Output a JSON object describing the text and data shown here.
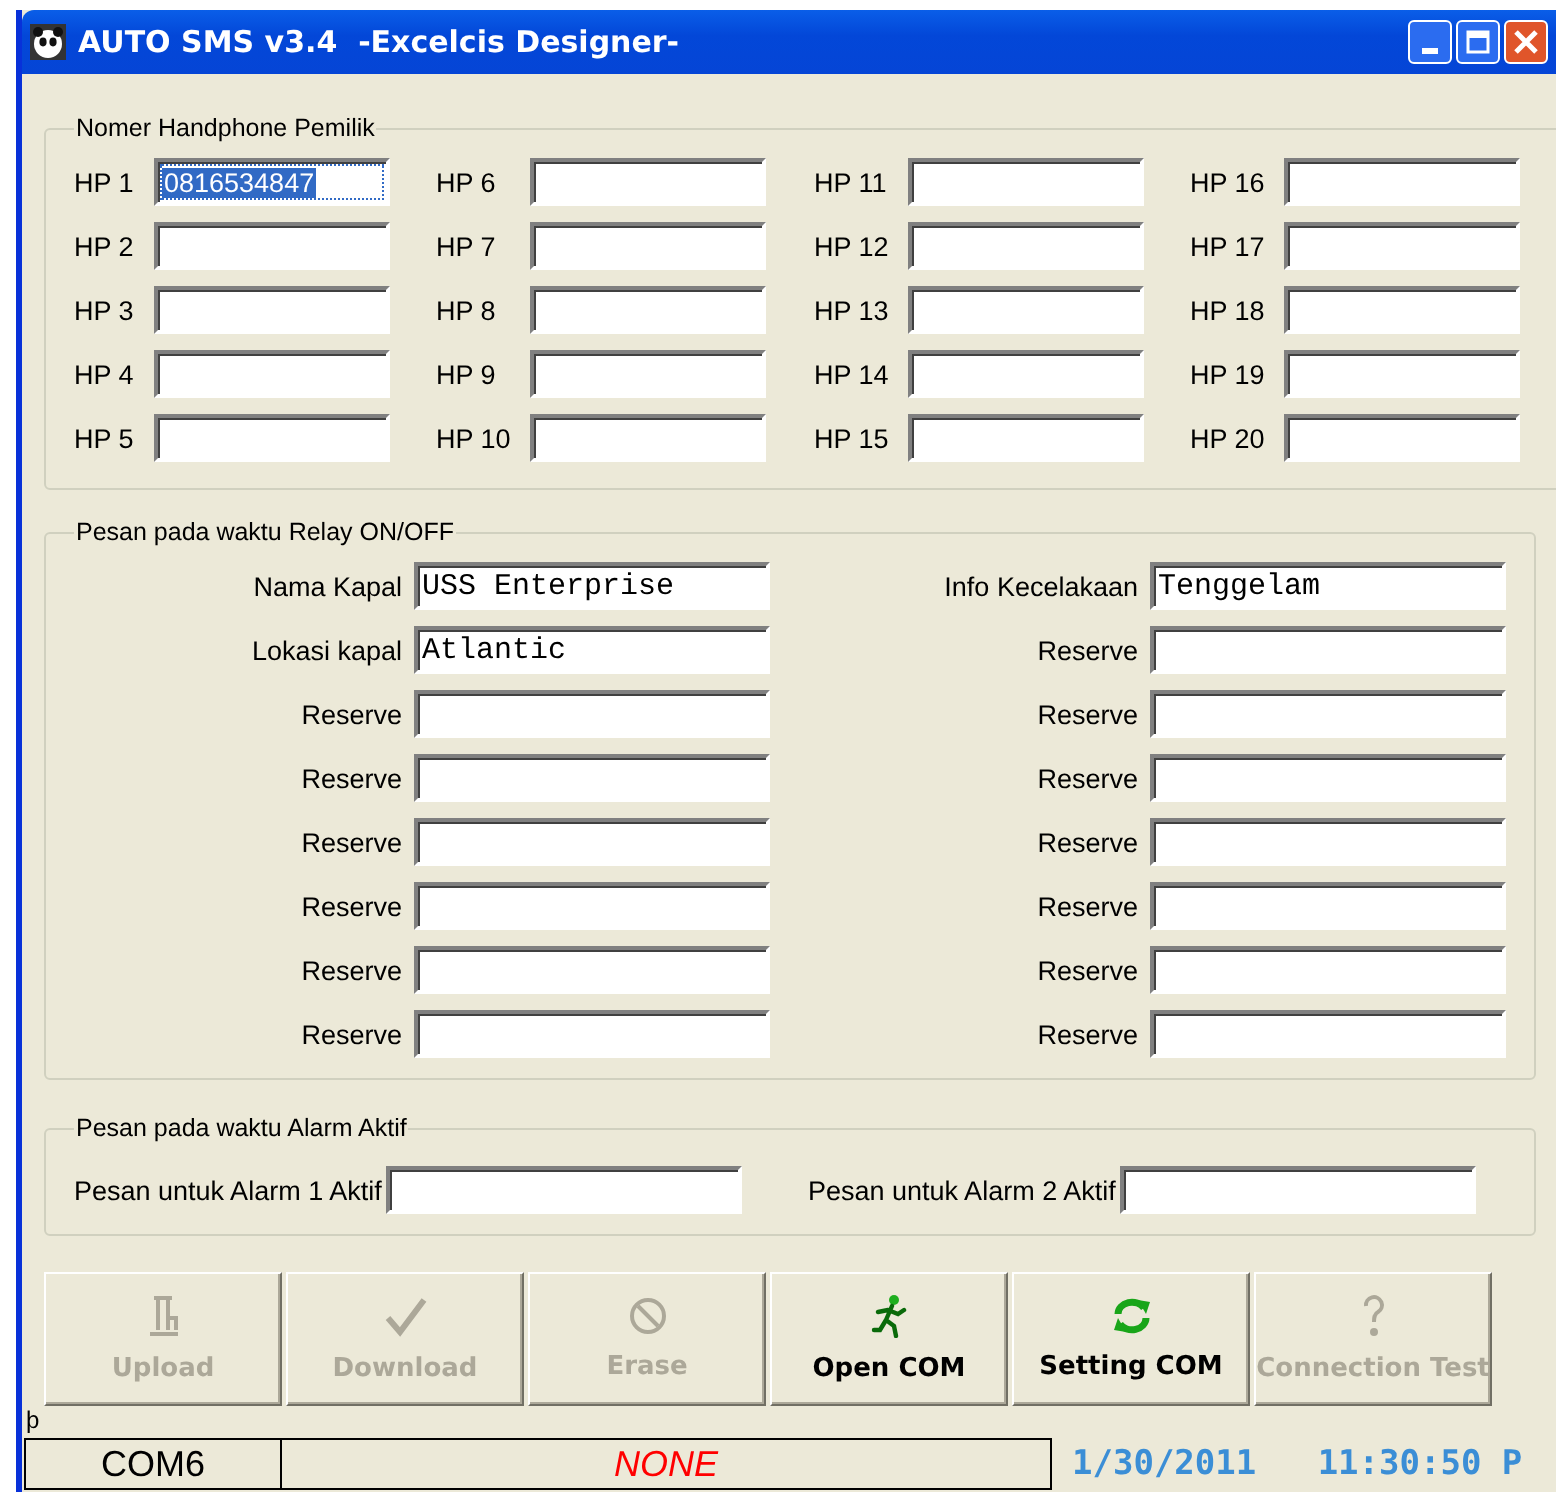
{
  "window": {
    "title": "AUTO SMS v3.4  -Excelcis Designer-"
  },
  "owner_phones": {
    "title": "Nomer Handphone Pemilik",
    "fields": [
      {
        "label": "HP 1",
        "value": "0816534847",
        "selected": true
      },
      {
        "label": "HP 2",
        "selected": false
      },
      {
        "label": "HP 3",
        "selected": false
      },
      {
        "label": "HP 4",
        "selected": false
      },
      {
        "label": "HP 5",
        "selected": false
      },
      {
        "label": "HP 6",
        "selected": false
      },
      {
        "label": "HP 7",
        "selected": false
      },
      {
        "label": "HP 8",
        "selected": false
      },
      {
        "label": "HP 9",
        "selected": false
      },
      {
        "label": "HP 10",
        "selected": false
      },
      {
        "label": "HP 11",
        "selected": false
      },
      {
        "label": "HP 12",
        "selected": false
      },
      {
        "label": "HP 13",
        "selected": false
      },
      {
        "label": "HP 14",
        "selected": false
      },
      {
        "label": "HP 15",
        "selected": false
      },
      {
        "label": "HP 16",
        "selected": false
      },
      {
        "label": "HP 17",
        "selected": false
      },
      {
        "label": "HP 18",
        "selected": false
      },
      {
        "label": "HP 19",
        "selected": false
      },
      {
        "label": "HP 20",
        "selected": false
      }
    ]
  },
  "relay_messages": {
    "title": "Pesan pada waktu Relay ON/OFF",
    "left": [
      {
        "label": "Nama Kapal",
        "value": "USS Enterprise"
      },
      {
        "label": "Lokasi kapal",
        "value": "Atlantic"
      },
      {
        "label": "Reserve"
      },
      {
        "label": "Reserve"
      },
      {
        "label": "Reserve"
      },
      {
        "label": "Reserve"
      },
      {
        "label": "Reserve"
      },
      {
        "label": "Reserve"
      }
    ],
    "right": [
      {
        "label": "Info Kecelakaan",
        "value": "Tenggelam"
      },
      {
        "label": "Reserve"
      },
      {
        "label": "Reserve"
      },
      {
        "label": "Reserve"
      },
      {
        "label": "Reserve"
      },
      {
        "label": "Reserve"
      },
      {
        "label": "Reserve"
      },
      {
        "label": "Reserve"
      }
    ]
  },
  "alarm_messages": {
    "title": "Pesan pada waktu Alarm Aktif",
    "fields": [
      {
        "label": "Pesan untuk Alarm 1 Aktif"
      },
      {
        "label": "Pesan untuk Alarm 2 Aktif"
      }
    ]
  },
  "buttons": [
    {
      "label": "Upload",
      "kind": "upload",
      "disabled": true
    },
    {
      "label": "Download",
      "kind": "download",
      "disabled": true
    },
    {
      "label": "Erase",
      "kind": "erase",
      "disabled": true
    },
    {
      "label": "Open COM",
      "kind": "open",
      "disabled": false
    },
    {
      "label": "Setting COM",
      "kind": "setting",
      "disabled": false
    },
    {
      "label": "Connection Test",
      "kind": "test",
      "disabled": true
    }
  ],
  "marker": "þ",
  "status_bar": {
    "port": "COM6",
    "state": "NONE",
    "datetime": "1/30/2011   11:30:50 P"
  }
}
